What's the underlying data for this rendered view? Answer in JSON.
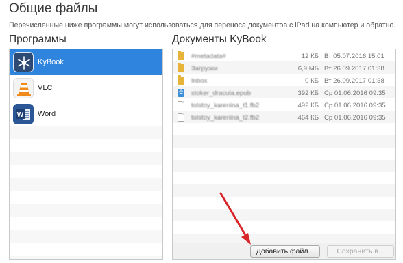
{
  "header": {
    "title": "Общие файлы",
    "subtitle": "Перечисленные ниже программы могут использоваться для переноса документов с iPad на компьютер и обратно."
  },
  "apps_panel": {
    "heading": "Программы",
    "items": [
      {
        "label": "KyBook",
        "icon": "kybook-icon",
        "selected": true
      },
      {
        "label": "VLC",
        "icon": "vlc-icon",
        "selected": false
      },
      {
        "label": "Word",
        "icon": "word-icon",
        "selected": false
      }
    ]
  },
  "docs_panel": {
    "heading": "Документы KyBook",
    "files": [
      {
        "name": "#metadata#",
        "type": "folder",
        "size": "12 КБ",
        "date": "Вт 05.07.2016 15:01"
      },
      {
        "name": "Загрузки",
        "type": "folder",
        "size": "6,9 МБ",
        "date": "Вт 26.09.2017 01:38"
      },
      {
        "name": "Inbox",
        "type": "folder",
        "size": "0 КБ",
        "date": "Вт 26.09.2017 01:38"
      },
      {
        "name": "stoker_dracula.epub",
        "type": "epub",
        "size": "392 КБ",
        "date": "Ср 01.06.2016 09:35"
      },
      {
        "name": "tolstoy_karenina_t1.fb2",
        "type": "document",
        "size": "492 КБ",
        "date": "Ср 01.06.2016 09:35"
      },
      {
        "name": "tolstoy_karenina_t2.fb2",
        "type": "document",
        "size": "464 КБ",
        "date": "Ср 01.06.2016 09:35"
      }
    ],
    "buttons": {
      "add": "Добавить файл...",
      "save": "Сохранить в..."
    }
  },
  "colors": {
    "selection": "#2f84dd",
    "annotation_arrow": "#d9252a"
  }
}
